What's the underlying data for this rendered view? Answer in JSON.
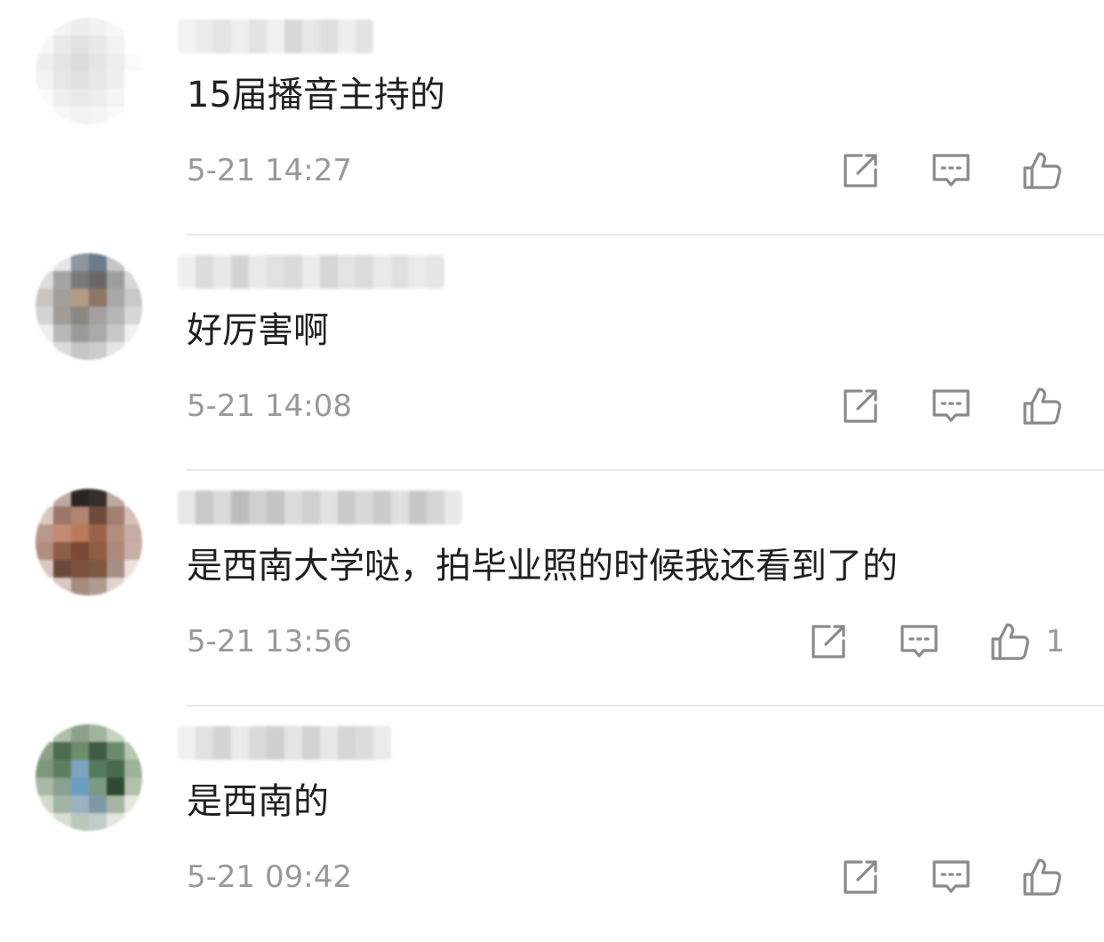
{
  "comments": [
    {
      "text": "15届播音主持的",
      "time": "5-21 14:27",
      "likes": "",
      "avatar_colors": [
        "#ffffff",
        "#f4f4f4",
        "#ececec",
        "#f1f1f1",
        "#f7f7f7",
        "#ffffff",
        "#f7f7f7",
        "#e9e9e9",
        "#e1e1e1",
        "#e8e8e8",
        "#f2f2f2",
        "#ffffff",
        "#efefef",
        "#e4e4e4",
        "#dcdcdc",
        "#e5e5e5",
        "#eeeeee",
        "#fafafa",
        "#f3f3f3",
        "#e6e6e6",
        "#e0e0e0",
        "#e7e7e7",
        "#efefef",
        "#ffffff",
        "#fafafa",
        "#efefef",
        "#e9e9e9",
        "#ededed",
        "#f4f4f4",
        "#ffffff",
        "#ffffff",
        "#f7f7f7",
        "#f2f2f2",
        "#f4f4f4",
        "#fafafa",
        "#ffffff"
      ],
      "name_colors": [
        "#f2f2f2",
        "#ebebeb",
        "#e4e4e4",
        "#eeeeee",
        "#e2e2e2",
        "#f0f0f0",
        "#d8d8d8",
        "#e6e6e6",
        "#dedede",
        "#eeeeee",
        "#e3e3e3"
      ]
    },
    {
      "text": "好厉害啊",
      "time": "5-21 14:08",
      "likes": "",
      "avatar_colors": [
        "#ffffff",
        "#e6e6e6",
        "#8c95a2",
        "#6c7b8c",
        "#c6c6c6",
        "#ffffff",
        "#dddddd",
        "#a4a4a4",
        "#7a7a7a",
        "#6a6767",
        "#9e9e9e",
        "#d8d8d8",
        "#c9c6c2",
        "#a39e98",
        "#b39a84",
        "#8d7665",
        "#a8a8a8",
        "#c8c8c8",
        "#d3d3d3",
        "#a09c99",
        "#8b8783",
        "#a2a09e",
        "#b5b5b5",
        "#d6d6d6",
        "#eeeeee",
        "#b8b8b8",
        "#9a9a9a",
        "#aaaaaa",
        "#c7c7c7",
        "#f0f0f0",
        "#ffffff",
        "#dcdcdc",
        "#c6c6c6",
        "#cccccc",
        "#e5e5e5",
        "#ffffff"
      ],
      "name_colors": [
        "#efefef",
        "#dcdcdc",
        "#e8e8e8",
        "#d3d3d3",
        "#e9e9e9",
        "#e1e1e1",
        "#dadada",
        "#ececec",
        "#d6d6d6",
        "#e4e4e4",
        "#dbdbdb",
        "#eaeaea",
        "#e0e0e0",
        "#ebebeb",
        "#e5e5e5"
      ]
    },
    {
      "text": "是西南大学哒，拍毕业照的时候我还看到了的",
      "time": "5-21 13:56",
      "likes": "1",
      "avatar_colors": [
        "#ffffff",
        "#bda7a0",
        "#2b2624",
        "#36302d",
        "#c0a8a0",
        "#ffffff",
        "#d9c7c0",
        "#9b7768",
        "#b08472",
        "#6e4b3a",
        "#a27f70",
        "#d6c1b8",
        "#b8988b",
        "#c48a72",
        "#b9795c",
        "#9e6248",
        "#b38d7d",
        "#c9aca0",
        "#b08e80",
        "#8d5e48",
        "#7a4a34",
        "#8f5d45",
        "#ad8a7b",
        "#c8aea4",
        "#d8c8c2",
        "#6b4a3b",
        "#7a503b",
        "#7e5641",
        "#a88e84",
        "#ece2de",
        "#ffffff",
        "#d8c9c3",
        "#a68b7f",
        "#b19a90",
        "#e0d4d0",
        "#ffffff"
      ],
      "name_colors": [
        "#e6e6e6",
        "#c8c8c8",
        "#d9d9d9",
        "#bcbcbc",
        "#d0d0d0",
        "#c4c4c4",
        "#dcdcdc",
        "#cfcfcf",
        "#e2e2e2",
        "#c9c9c9",
        "#d7d7d7",
        "#cbcbcb",
        "#e0e0e0",
        "#c6c6c6",
        "#d5d5d5",
        "#e8e8e8"
      ]
    },
    {
      "text": "是西南的",
      "time": "5-21 09:42",
      "likes": "",
      "avatar_colors": [
        "#ffffff",
        "#b0c0a8",
        "#8da08a",
        "#a3b49c",
        "#c7d2c0",
        "#ffffff",
        "#8da28a",
        "#4d6b4e",
        "#6f8c6c",
        "#3f5c43",
        "#6c8a6b",
        "#b7c6b0",
        "#7c987a",
        "#5e7d5f",
        "#7fa3bf",
        "#537a5c",
        "#4a6a4e",
        "#9db29a",
        "#a9b9a4",
        "#8aa090",
        "#6b9dc6",
        "#7c9a80",
        "#2e4a34",
        "#b0c0aa",
        "#d2dbce",
        "#a2b4a3",
        "#9cb2c2",
        "#7f99a4",
        "#a6b6a2",
        "#e2e8df",
        "#ffffff",
        "#d7ded3",
        "#b9c7bd",
        "#c1ccc5",
        "#e1e6de",
        "#ffffff"
      ],
      "name_colors": [
        "#f0f0f0",
        "#e1e1e1",
        "#d4d4d4",
        "#eaeaea",
        "#d9d9d9",
        "#cfcfcf",
        "#e4e4e4",
        "#d2d2d2",
        "#e7e7e7",
        "#d6d6d6",
        "#dcdcdc",
        "#ebebeb"
      ]
    }
  ],
  "icons": {
    "share": "share-icon",
    "reply": "comment-icon",
    "like": "thumbs-up-icon"
  },
  "colors": {
    "text": "#1f1f1f",
    "meta": "#999999",
    "divider": "#e6e6e6",
    "icon": "#8a8a8a"
  }
}
